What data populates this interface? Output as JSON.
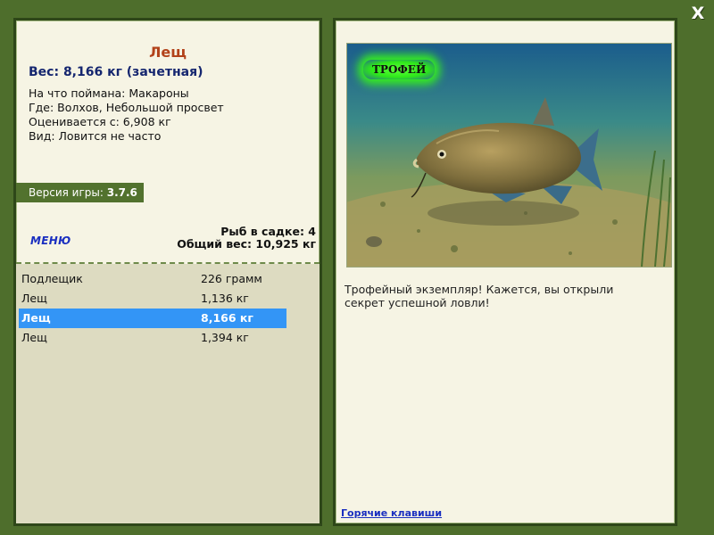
{
  "window": {
    "close_label": "X"
  },
  "catch": {
    "title": "Лещ",
    "weight_line": "Вес: 8,166 кг (зачетная)",
    "details": [
      "На что поймана: Макароны",
      "Где: Волхов, Небольшой просвет",
      "Оценивается с: 6,908 кг",
      "Вид: Ловится не часто"
    ]
  },
  "version": {
    "label": "Версия игры:",
    "value": "3.7.6"
  },
  "menu": {
    "label": "МЕНЮ"
  },
  "keepnet": {
    "count_line": "Рыб в садке: 4",
    "total_line": "Общий вес: 10,925 кг"
  },
  "fish_list": [
    {
      "name": "Подлещик",
      "weight": "226 грамм",
      "selected": false
    },
    {
      "name": "Лещ",
      "weight": "1,136 кг",
      "selected": false
    },
    {
      "name": "Лещ",
      "weight": "8,166 кг",
      "selected": true
    },
    {
      "name": "Лещ",
      "weight": "1,394 кг",
      "selected": false
    }
  ],
  "photo": {
    "badge": "ТРОФЕЙ"
  },
  "description": "Трофейный экземпляр! Кажется, вы открыли секрет успешной ловли!",
  "hotkeys": {
    "label": "Горячие клавиши"
  },
  "colors": {
    "background": "#4e6e2c",
    "panel": "#f6f4e4",
    "title": "#b2421a",
    "weight": "#15266f",
    "link": "#1a2fc0",
    "selection": "#3395f6"
  }
}
